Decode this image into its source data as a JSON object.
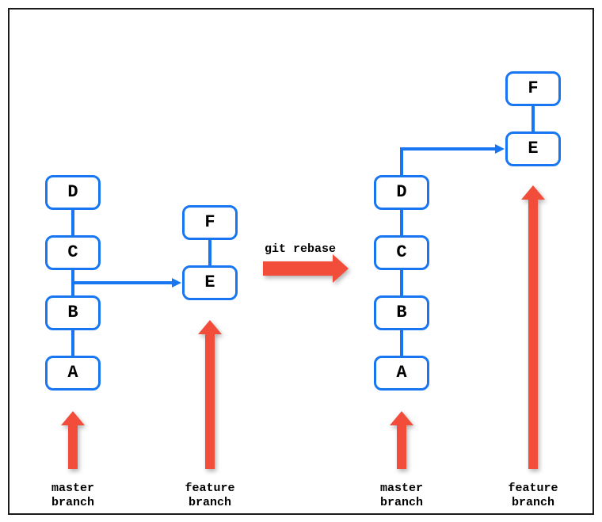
{
  "diagram": {
    "before": {
      "master": {
        "A": "A",
        "B": "B",
        "C": "C",
        "D": "D",
        "label": "master\nbranch"
      },
      "feature": {
        "E": "E",
        "F": "F",
        "label": "feature\nbranch"
      }
    },
    "after": {
      "master": {
        "A": "A",
        "B": "B",
        "C": "C",
        "D": "D",
        "label": "master\nbranch"
      },
      "feature": {
        "E": "E",
        "F": "F",
        "label": "feature\nbranch"
      }
    },
    "command": "git rebase"
  },
  "colors": {
    "blue": "#1976f2",
    "red": "#f24d3a"
  }
}
